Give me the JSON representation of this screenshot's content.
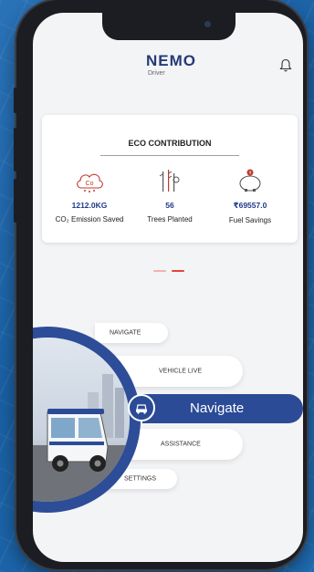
{
  "header": {
    "logo_main": "NEMO",
    "logo_sub": "Driver"
  },
  "eco": {
    "title": "ECO CONTRIBUTION",
    "stats": [
      {
        "value": "1212.0KG",
        "label": "CO₂ Emission Saved",
        "icon": "co2-cloud-icon"
      },
      {
        "value": "56",
        "label": "Trees Planted",
        "icon": "trees-icon"
      },
      {
        "value": "₹69557.0",
        "label": "Fuel Savings",
        "icon": "piggy-bank-icon"
      }
    ]
  },
  "pager": {
    "count": 2,
    "active_index": 1
  },
  "menu": {
    "items": [
      "NAVIGATE",
      "VEHICLE LIVE",
      "Navigate",
      "ASSISTANCE",
      "SETTINGS"
    ],
    "active_index": 2
  },
  "colors": {
    "brand": "#2b4b97",
    "accent_red": "#e0443e",
    "value_text": "#1f3a8a",
    "background": "#1a5fa3"
  }
}
